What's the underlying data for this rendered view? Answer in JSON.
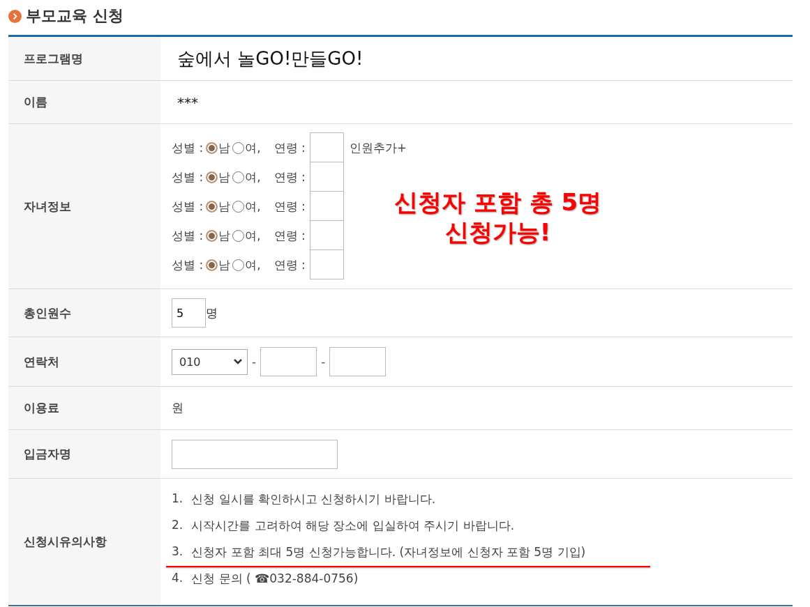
{
  "section_title": "부모교육 신청",
  "rows": [
    {
      "kind": "large_text",
      "label": "프로그램명",
      "value": "숲에서 놀GO!만들GO!"
    },
    {
      "kind": "text",
      "label": "이름",
      "value": "***"
    },
    {
      "kind": "children",
      "label": "자녀정보",
      "add_link": "인원추가+",
      "children": [
        {
          "gender_label": "성별 :",
          "options": [
            {
              "label": "남",
              "selected": true
            },
            {
              "label": "여,",
              "selected": false
            }
          ],
          "age_label": "연령 :"
        },
        {
          "gender_label": "성별 :",
          "options": [
            {
              "label": "남",
              "selected": true
            },
            {
              "label": "여,",
              "selected": false
            }
          ],
          "age_label": "연령 :"
        },
        {
          "gender_label": "성별 :",
          "options": [
            {
              "label": "남",
              "selected": true
            },
            {
              "label": "여,",
              "selected": false
            }
          ],
          "age_label": "연령 :"
        },
        {
          "gender_label": "성별 :",
          "options": [
            {
              "label": "남",
              "selected": true
            },
            {
              "label": "여,",
              "selected": false
            }
          ],
          "age_label": "연령 :"
        },
        {
          "gender_label": "성별 :",
          "options": [
            {
              "label": "남",
              "selected": true
            },
            {
              "label": "여,",
              "selected": false
            }
          ],
          "age_label": "연령 :"
        }
      ],
      "annotation": [
        "신청자 포함 총 5명",
        "신청가능!"
      ]
    },
    {
      "kind": "count",
      "label": "총인원수",
      "value": "5",
      "unit": "명"
    },
    {
      "kind": "phone",
      "label": "연락처",
      "prefix": "010",
      "separators": [
        "-",
        "-"
      ]
    },
    {
      "kind": "text",
      "label": "이용료",
      "value": "원"
    },
    {
      "kind": "input",
      "label": "입금자명"
    },
    {
      "kind": "notes",
      "label": "신청시유의사항",
      "items": [
        {
          "number": "1.",
          "text": "신청 일시를 확인하시고 신청하시기 바랍니다.",
          "underlined": false
        },
        {
          "number": "2.",
          "text": "시작시간를 고려하여 해당 장소에 입실하여 주시기 바랍니다.",
          "underlined": false
        },
        {
          "number": "3.",
          "text": "신청자 포함 최대 5명 신청가능합니다. (자녀정보에 신청자 포함 5명 기입)",
          "underlined": true
        },
        {
          "number": "4.",
          "text": "신청 문의 ( ☎032-884-0756)",
          "underlined": false
        }
      ]
    }
  ]
}
